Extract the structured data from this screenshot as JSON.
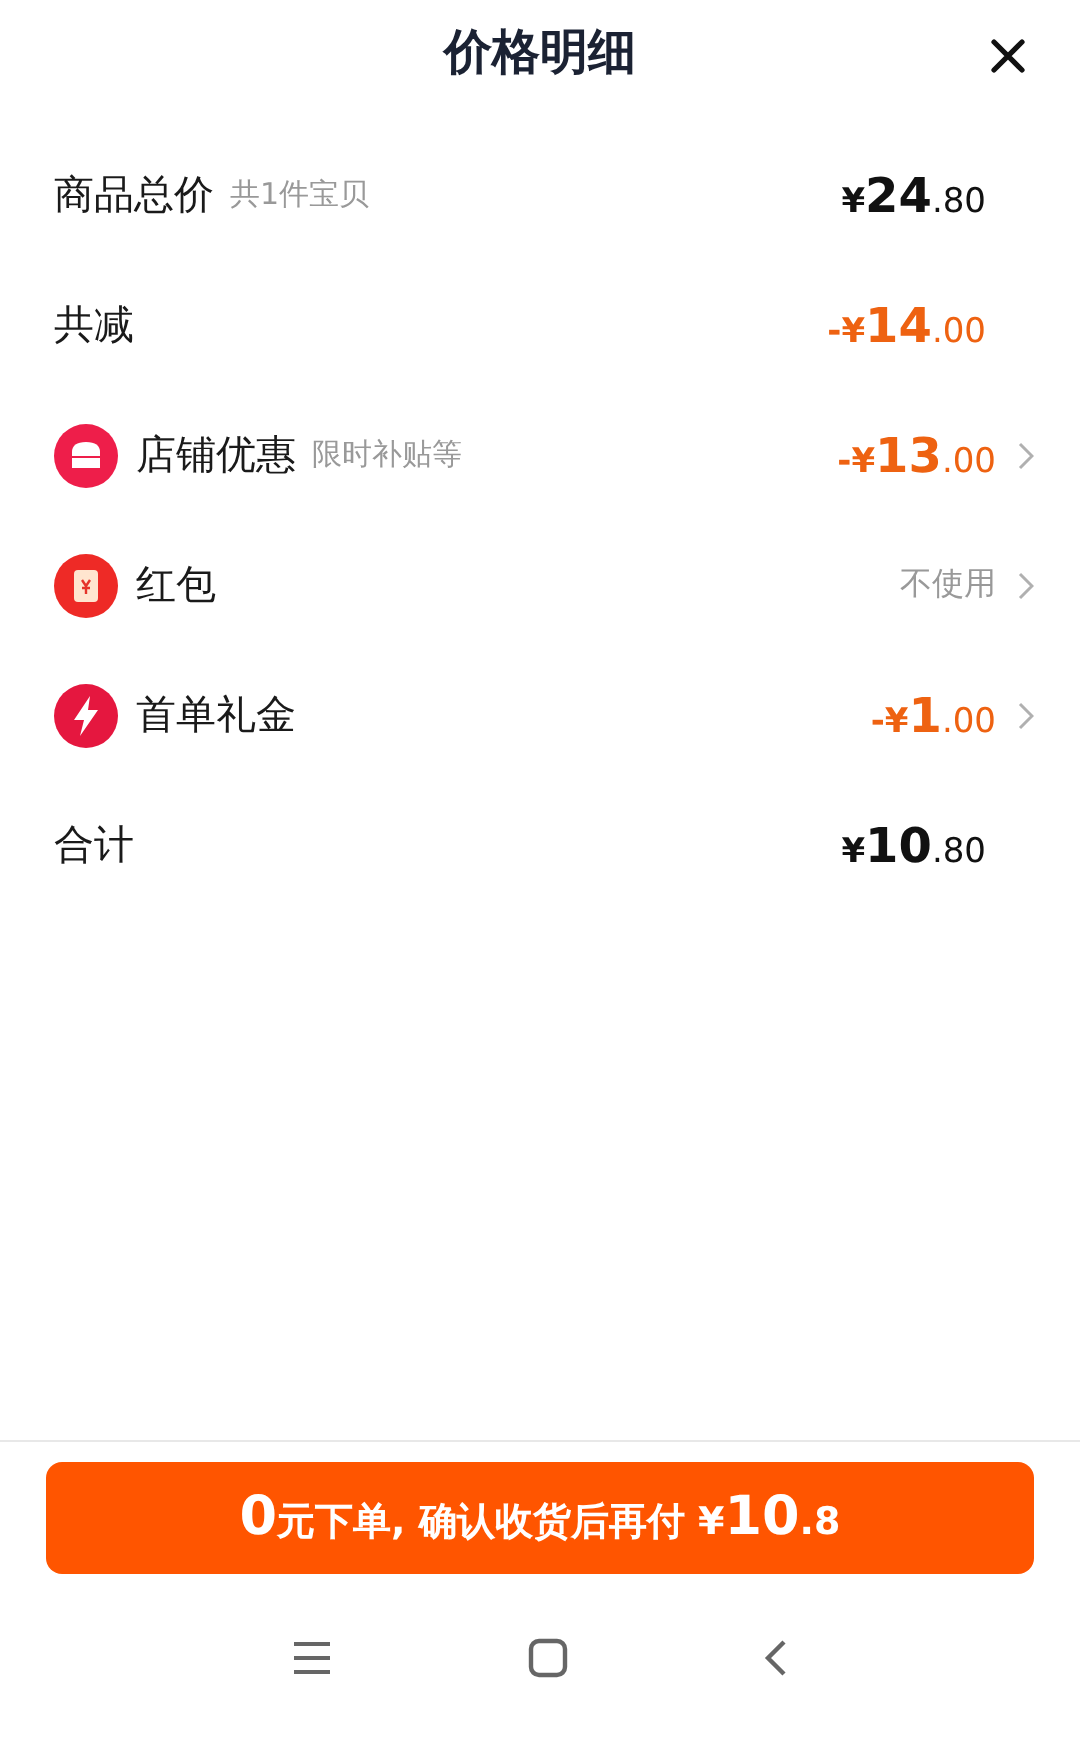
{
  "header": {
    "title": "价格明细"
  },
  "rows": [
    {
      "kind": "plain",
      "label": "商品总价",
      "note": "共1件宝贝",
      "highlight": false,
      "amount": {
        "sign": "¥",
        "integer": "24",
        "decimal": ".80"
      }
    },
    {
      "kind": "plain",
      "label": "共减",
      "highlight": true,
      "amount": {
        "sign": "-¥",
        "integer": "14",
        "decimal": ".00"
      }
    },
    {
      "kind": "shop",
      "label": "店铺优惠",
      "note": "限时补贴等",
      "highlight": true,
      "amount": {
        "sign": "-¥",
        "integer": "13",
        "decimal": ".00"
      }
    },
    {
      "kind": "envelope",
      "label": "红包",
      "highlight": false,
      "value": "不使用"
    },
    {
      "kind": "bolt",
      "label": "首单礼金",
      "highlight": true,
      "amount": {
        "sign": "-¥",
        "integer": "1",
        "decimal": ".00"
      }
    },
    {
      "kind": "plain",
      "label": "合计",
      "highlight": false,
      "amount": {
        "sign": "¥",
        "integer": "10",
        "decimal": ".80"
      }
    }
  ],
  "pay_button": {
    "parts": [
      {
        "text": "0",
        "big": true
      },
      {
        "text": "元下单, 确认收货后再付 ",
        "big": false
      },
      {
        "text": "¥",
        "big": false
      },
      {
        "text": "10",
        "big": true
      },
      {
        "text": ".8",
        "big": false
      }
    ]
  }
}
